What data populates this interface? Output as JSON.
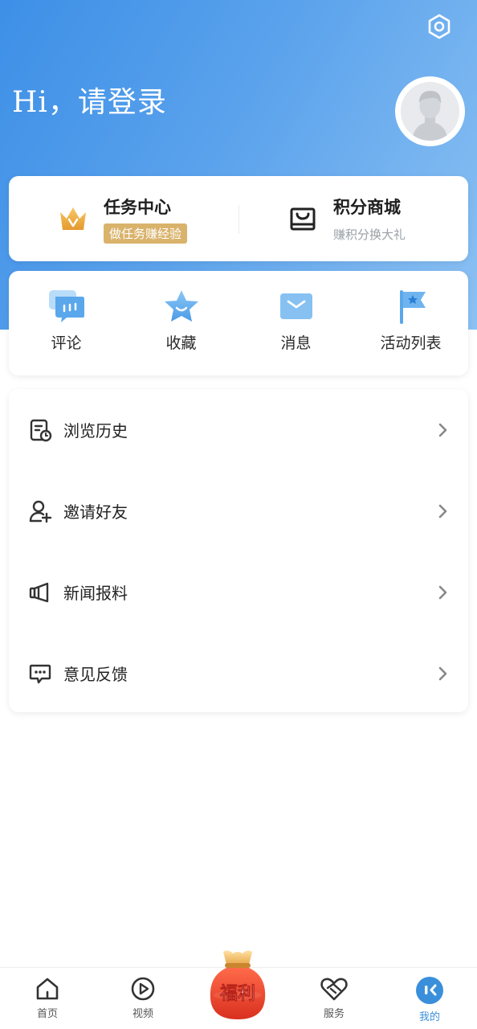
{
  "header": {
    "greeting": "Hi，请登录",
    "settings_icon": "settings-hexagon-icon",
    "avatar_icon": "default-avatar-icon"
  },
  "promos": {
    "task_center": {
      "title": "任务中心",
      "badge": "做任务赚经验",
      "icon": "crown-icon"
    },
    "points_mall": {
      "title": "积分商城",
      "subtitle": "赚积分换大礼",
      "icon": "shopping-bag-icon"
    }
  },
  "quick_actions": [
    {
      "label": "评论",
      "icon": "comment-bubbles-icon"
    },
    {
      "label": "收藏",
      "icon": "star-icon"
    },
    {
      "label": "消息",
      "icon": "envelope-icon"
    },
    {
      "label": "活动列表",
      "icon": "flag-icon"
    }
  ],
  "menu": [
    {
      "label": "浏览历史",
      "icon": "history-document-icon"
    },
    {
      "label": "邀请好友",
      "icon": "add-user-icon"
    },
    {
      "label": "新闻报料",
      "icon": "megaphone-icon"
    },
    {
      "label": "意见反馈",
      "icon": "feedback-chat-icon"
    }
  ],
  "tabbar": {
    "tabs": [
      {
        "label": "首页",
        "icon": "home-icon"
      },
      {
        "label": "视频",
        "icon": "play-circle-icon"
      },
      {
        "label": "服务",
        "icon": "heart-handshake-icon"
      },
      {
        "label": "我的",
        "icon": "mine-face-icon",
        "active": true
      }
    ],
    "center": {
      "label": "福利",
      "icon": "lucky-bag-icon"
    }
  },
  "colors": {
    "header_gradient_start": "#3d8fe7",
    "header_gradient_end": "#8cc1f3",
    "accent_blue": "#3a8fdb",
    "badge_gold": "#d9b36c",
    "fuli_red": "#e8432e"
  }
}
